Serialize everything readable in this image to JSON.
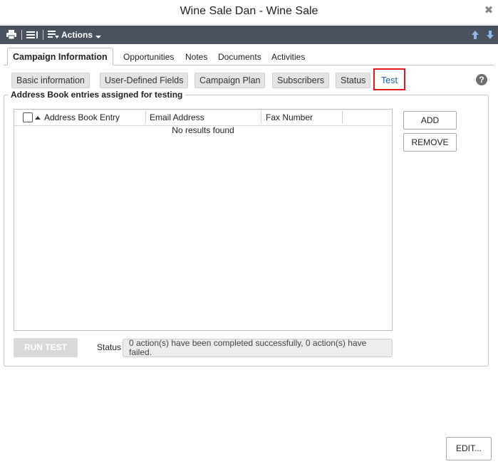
{
  "window": {
    "title": "Wine Sale Dan - Wine Sale"
  },
  "toolbar": {
    "actions_label": "Actions"
  },
  "tabs": [
    {
      "label": "Campaign Information",
      "active": true
    },
    {
      "label": "Opportunities"
    },
    {
      "label": "Notes"
    },
    {
      "label": "Documents"
    },
    {
      "label": "Activities"
    }
  ],
  "subtabs": [
    {
      "label": "Basic information"
    },
    {
      "label": "User-Defined Fields"
    },
    {
      "label": "Campaign Plan"
    },
    {
      "label": "Subscribers"
    },
    {
      "label": "Status"
    },
    {
      "label": "Test",
      "active": true
    }
  ],
  "section": {
    "legend": "Address Book entries assigned for testing"
  },
  "grid": {
    "columns": [
      "Address Book Entry",
      "Email Address",
      "Fax Number"
    ],
    "empty_text": "No results found"
  },
  "buttons": {
    "add": "ADD",
    "remove": "REMOVE",
    "run_test": "RUN TEST",
    "edit": "EDIT..."
  },
  "status": {
    "label": "Status",
    "text": "0 action(s) have been completed successfully, 0 action(s) have failed."
  },
  "colors": {
    "toolbar_bg": "#4a5260",
    "active_subtab_text": "#1a5fb4",
    "highlight": "#e0191f"
  }
}
